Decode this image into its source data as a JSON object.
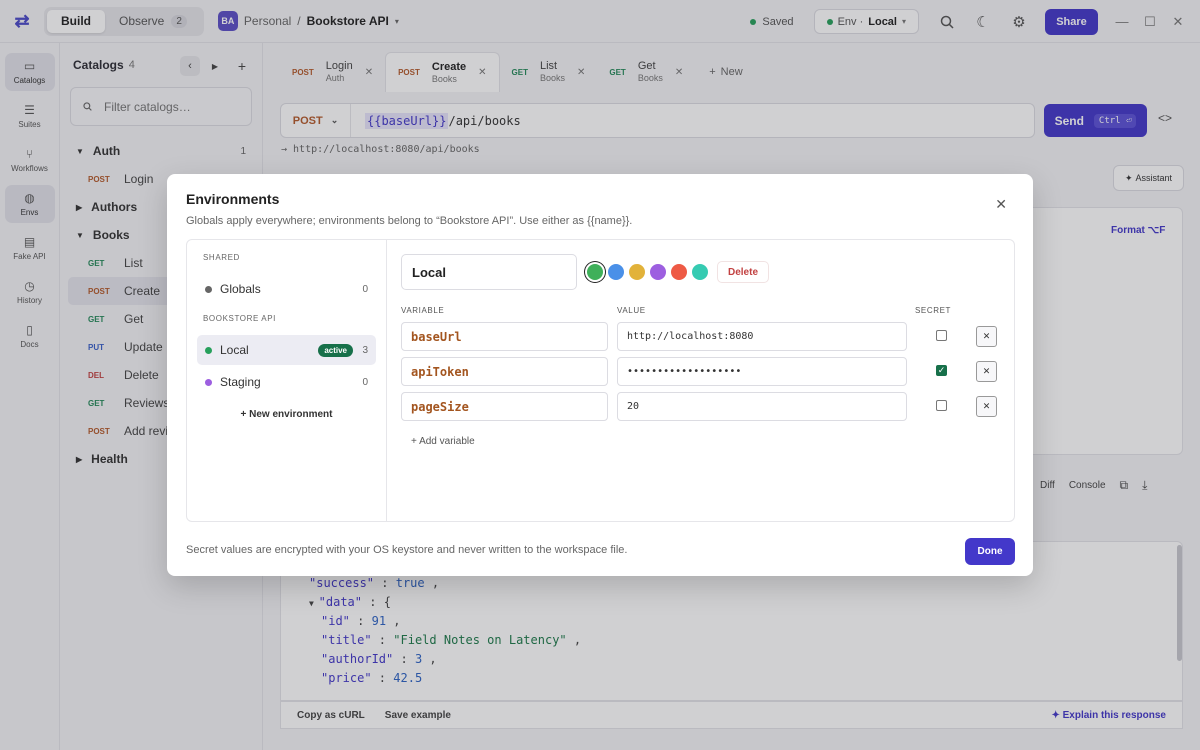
{
  "topbar": {
    "tabs": [
      {
        "label": "Build"
      },
      {
        "label": "Observe",
        "count": "2"
      }
    ],
    "workspace_initials": "BA",
    "workspace": "Personal",
    "separator": "/",
    "project": "Bookstore API",
    "saved": "Saved",
    "env_prefix": "Env ·",
    "env_value": "Local",
    "share": "Share"
  },
  "rail": [
    {
      "label": "Catalogs",
      "icon": "folder-icon"
    },
    {
      "label": "Suites",
      "icon": "checklist-icon"
    },
    {
      "label": "Workflows",
      "icon": "workflow-icon"
    },
    {
      "label": "Envs",
      "icon": "globe-icon"
    },
    {
      "label": "Fake API",
      "icon": "server-icon"
    },
    {
      "label": "History",
      "icon": "clock-icon"
    },
    {
      "label": "Docs",
      "icon": "doc-icon"
    }
  ],
  "sidebar": {
    "title": "Catalogs",
    "count": "4",
    "filter_placeholder": "Filter catalogs…",
    "groups": {
      "auth": {
        "name": "Auth",
        "count": "1",
        "items": [
          {
            "method": "POST",
            "name": "Login"
          }
        ]
      },
      "authors": {
        "name": "Authors"
      },
      "books": {
        "name": "Books",
        "items": [
          {
            "method": "GET",
            "name": "List"
          },
          {
            "method": "POST",
            "name": "Create"
          },
          {
            "method": "GET",
            "name": "Get"
          },
          {
            "method": "PUT",
            "name": "Update"
          },
          {
            "method": "DEL",
            "name": "Delete"
          },
          {
            "method": "GET",
            "name": "Reviews"
          },
          {
            "method": "POST",
            "name": "Add revi"
          }
        ]
      },
      "health": {
        "name": "Health"
      }
    }
  },
  "tabs": [
    {
      "method": "POST",
      "title": "Login",
      "sub": "Auth"
    },
    {
      "method": "POST",
      "title": "Create",
      "sub": "Books"
    },
    {
      "method": "GET",
      "title": "List",
      "sub": "Books"
    },
    {
      "method": "GET",
      "title": "Get",
      "sub": "Books"
    }
  ],
  "new_tab": "New",
  "request": {
    "method": "POST",
    "url_var": "{{baseUrl}}",
    "url_path": "/api/books",
    "send": "Send",
    "send_key": "Ctrl ⏎",
    "resolved": "→ http://localhost:8080/api/books",
    "assistant": "Assistant",
    "format": "Format ⌥F"
  },
  "response": {
    "tools": [
      "Diff",
      "Console"
    ],
    "lines": [
      {
        "k": "\"success\"",
        "v": "true"
      },
      {
        "k": "\"data\"",
        "v": "{"
      },
      {
        "k": "\"id\"",
        "v": "91"
      },
      {
        "k": "\"title\"",
        "v": "\"Field Notes on Latency\""
      },
      {
        "k": "\"authorId\"",
        "v": "3"
      },
      {
        "k": "\"price\"",
        "v": "42.5"
      }
    ],
    "copy_curl": "Copy as cURL",
    "save_example": "Save example",
    "explain": "Explain this response"
  },
  "modal": {
    "title": "Environments",
    "subtitle": "Globals apply everywhere; environments belong to “Bookstore API”. Use either as {{name}}.",
    "shared_label": "SHARED",
    "globals": {
      "name": "Globals",
      "count": "0"
    },
    "project_label": "BOOKSTORE API",
    "envs": [
      {
        "name": "Local",
        "count": "3",
        "badge": "active",
        "color": "#17704a"
      },
      {
        "name": "Staging",
        "count": "0",
        "color": "#9d5fe0"
      }
    ],
    "new_env": "New environment",
    "env_name": "Local",
    "swatches": [
      "#3fb05a",
      "#4a90e8",
      "#e2b23a",
      "#9d5fe0",
      "#ee5a45",
      "#36cbb2"
    ],
    "delete": "Delete",
    "col_variable": "VARIABLE",
    "col_value": "VALUE",
    "col_secret": "SECRET",
    "variables": [
      {
        "key": "baseUrl",
        "value": "http://localhost:8080",
        "secret": false
      },
      {
        "key": "apiToken",
        "value": "•••••••••••••••••••",
        "secret": true
      },
      {
        "key": "pageSize",
        "value": "20",
        "secret": false
      }
    ],
    "add_variable": "Add variable",
    "footer": "Secret values are encrypted with your OS keystore and never written to the workspace file.",
    "done": "Done"
  }
}
